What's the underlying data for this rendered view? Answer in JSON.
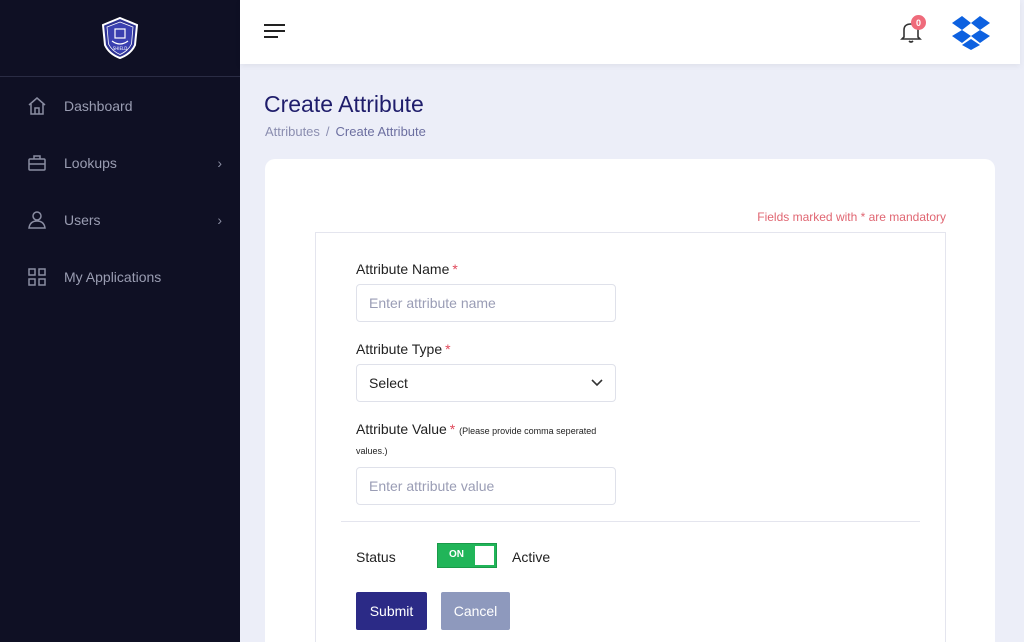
{
  "sidebar": {
    "logo_name": "shield-logo",
    "items": [
      {
        "label": "Dashboard",
        "icon": "home-icon",
        "has_submenu": false
      },
      {
        "label": "Lookups",
        "icon": "briefcase-icon",
        "has_submenu": true
      },
      {
        "label": "Users",
        "icon": "user-icon",
        "has_submenu": true
      },
      {
        "label": "My Applications",
        "icon": "grid-icon",
        "has_submenu": false
      }
    ]
  },
  "topbar": {
    "notification_count": "0"
  },
  "page": {
    "title": "Create Attribute",
    "breadcrumb": [
      "Attributes",
      "Create Attribute"
    ]
  },
  "form": {
    "mandatory_note": "Fields marked with * are mandatory",
    "attribute_name": {
      "label": "Attribute Name",
      "required": "*",
      "value": "",
      "placeholder": "Enter attribute name"
    },
    "attribute_type": {
      "label": "Attribute Type",
      "required": "*",
      "selected": "Select"
    },
    "attribute_value": {
      "label": "Attribute Value",
      "required": "*",
      "hint_line1": "(Please provide comma seperated",
      "hint_line2": "values.)",
      "value": "",
      "placeholder": "Enter attribute value"
    },
    "status": {
      "label": "Status",
      "toggle_text": "ON",
      "state_text": "Active",
      "on": true
    },
    "submit_label": "Submit",
    "cancel_label": "Cancel"
  },
  "colors": {
    "sidebar_bg": "#0f1024",
    "page_bg": "#eceef8",
    "title": "#1f1d6b",
    "submit": "#2b2a86",
    "cancel": "#8e99bd",
    "toggle_on": "#21b559",
    "required": "#e0485a",
    "badge": "#ef6b7b",
    "dropbox_blue": "#0d61e0"
  }
}
